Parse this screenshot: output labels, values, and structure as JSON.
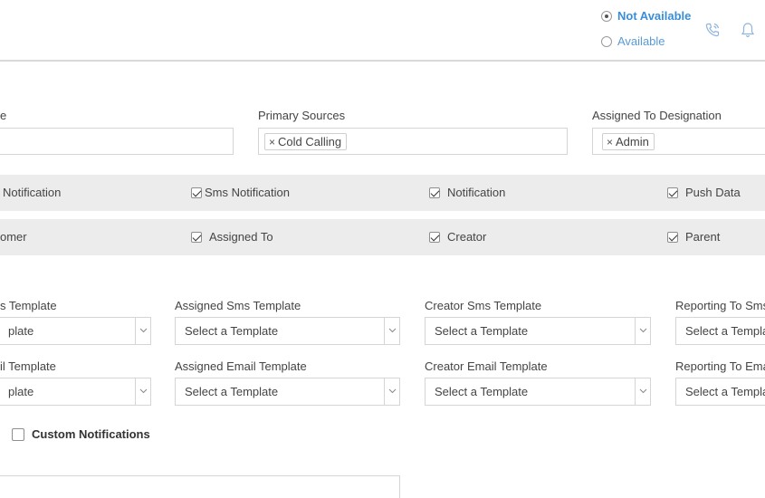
{
  "header": {
    "status_not_available": "Not Available",
    "status_available": "Available",
    "icons": [
      "phone-icon",
      "bell-icon"
    ]
  },
  "fields": {
    "first_label": "e",
    "primary_sources_label": "Primary Sources",
    "primary_sources_tag": "Cold Calling",
    "designation_label": "Assigned To Designation",
    "designation_tag": "Admin",
    "tag_remove": "×"
  },
  "notification_row": {
    "c1": "Notification",
    "c2": "Sms Notification",
    "c3": "Notification",
    "c4": "Push Data"
  },
  "recipient_row": {
    "c1": "omer",
    "c2": "Assigned To",
    "c3": "Creator",
    "c4": "Parent"
  },
  "templates": {
    "sms_labels": [
      "s Template",
      "Assigned Sms Template",
      "Creator Sms Template",
      "Reporting To Sms"
    ],
    "sms_values": [
      "plate",
      "Select a Template",
      "Select a Template",
      "Select a Templa"
    ],
    "email_labels": [
      "il Template",
      "Assigned Email Template",
      "Creator Email Template",
      "Reporting To Ema"
    ],
    "email_values": [
      "plate",
      "Select a Template",
      "Select a Template",
      "Select a Templa"
    ]
  },
  "custom_notifications_label": "Custom Notifications",
  "colors": {
    "accent": "#3a8ed8",
    "band": "#ececec",
    "border": "#d5d5d5"
  }
}
